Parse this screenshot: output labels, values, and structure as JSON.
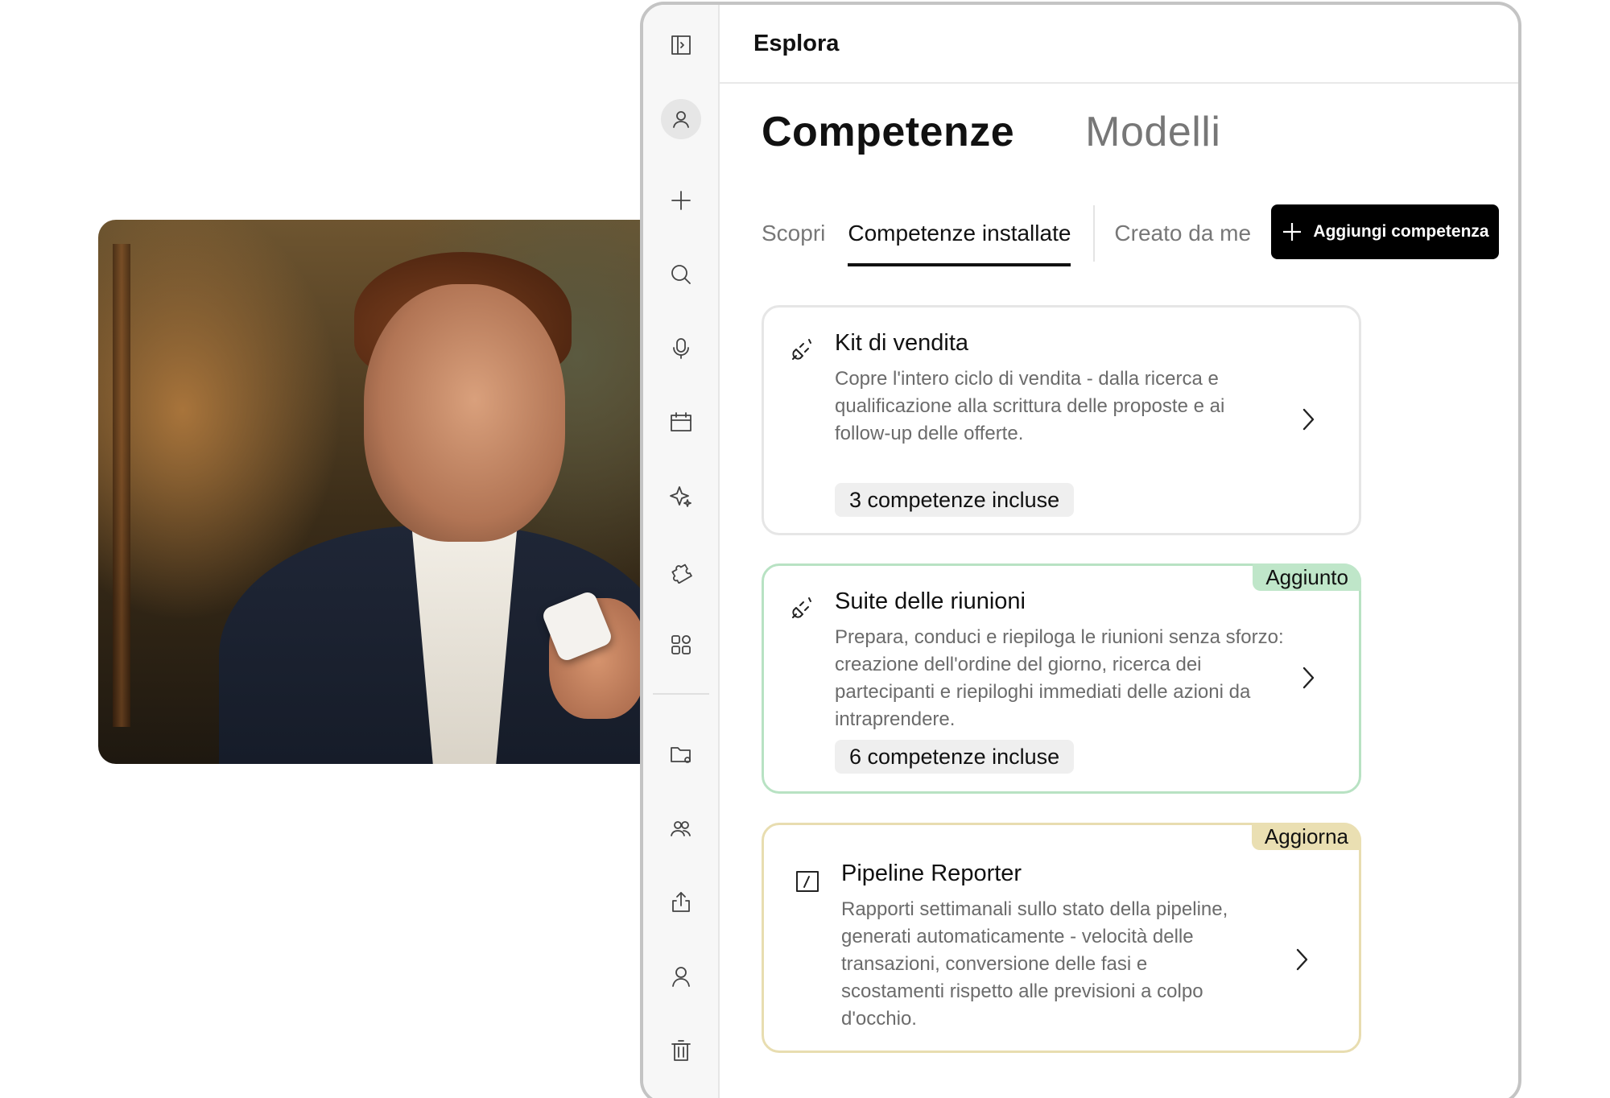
{
  "window": {
    "title": "Esplora"
  },
  "colors": {
    "accent": "#000000",
    "added": "#bfe6c9",
    "update": "#eadfb2"
  },
  "sidebar": {
    "icons": [
      "sidebar-toggle-icon",
      "profile-icon",
      "plus-icon",
      "search-icon",
      "microphone-icon",
      "calendar-icon",
      "sparkle-icon",
      "puzzle-icon",
      "apps-grid-icon",
      "folder-settings-icon",
      "people-icon",
      "share-icon",
      "user-icon",
      "trash-icon"
    ]
  },
  "main_tabs": [
    {
      "label": "Competenze",
      "active": true
    },
    {
      "label": "Modelli",
      "active": false
    }
  ],
  "sub_tabs": [
    {
      "label": "Scopri",
      "active": false
    },
    {
      "label": "Competenze installate",
      "active": true
    },
    {
      "label": "Creato da me",
      "active": false
    }
  ],
  "add_button": {
    "label": "Aggiungi competenza",
    "icon": "plus-icon"
  },
  "cards": [
    {
      "icon": "plug-icon",
      "title": "Kit di vendita",
      "description": "Copre l'intero ciclo di vendita - dalla ricerca e qualificazione alla scrittura delle proposte e ai follow-up delle offerte.",
      "pill": "3 competenze incluse"
    },
    {
      "icon": "plug-icon",
      "title": "Suite delle riunioni",
      "description": "Prepara, conduci e riepiloga le riunioni senza sforzo: creazione dell'ordine del giorno, ricerca dei partecipanti e riepiloghi immediati delle azioni da intraprendere.",
      "pill": "6 competenze incluse",
      "badge": "Aggiunto"
    },
    {
      "icon": "slash-box-icon",
      "title": "Pipeline Reporter",
      "description": "Rapporti settimanali sullo stato della pipeline, generati automaticamente - velocità delle transazioni, conversione delle fasi e scostamenti rispetto alle previsioni a colpo d'occhio.",
      "badge": "Aggiorna"
    }
  ]
}
